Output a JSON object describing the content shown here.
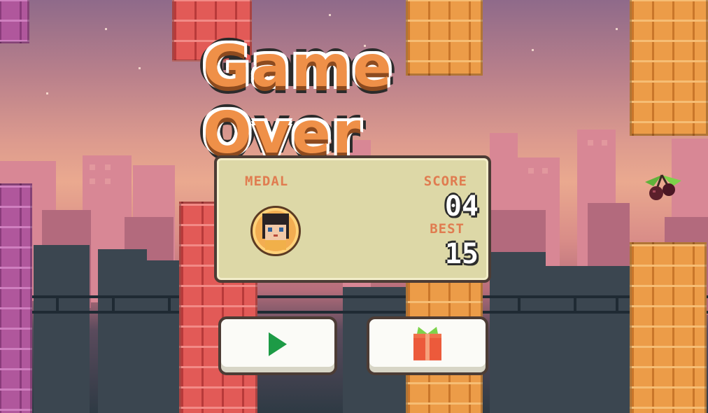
{
  "game_over": {
    "title": "Game Over",
    "panel": {
      "medal_label": "MEDAL",
      "score_label": "SCORE",
      "score_value": "04",
      "best_label": "BEST",
      "best_value": "15"
    },
    "buttons": {
      "play_icon": "play-icon",
      "gift_icon": "gift-icon"
    }
  },
  "colors": {
    "title_orange": "#ef9048",
    "panel_bg": "#ddd8a7",
    "label_orange": "#e07c50",
    "play_green": "#1d9b46",
    "gift_red": "#ec5a3b",
    "ribbon_green": "#7cd34a"
  }
}
